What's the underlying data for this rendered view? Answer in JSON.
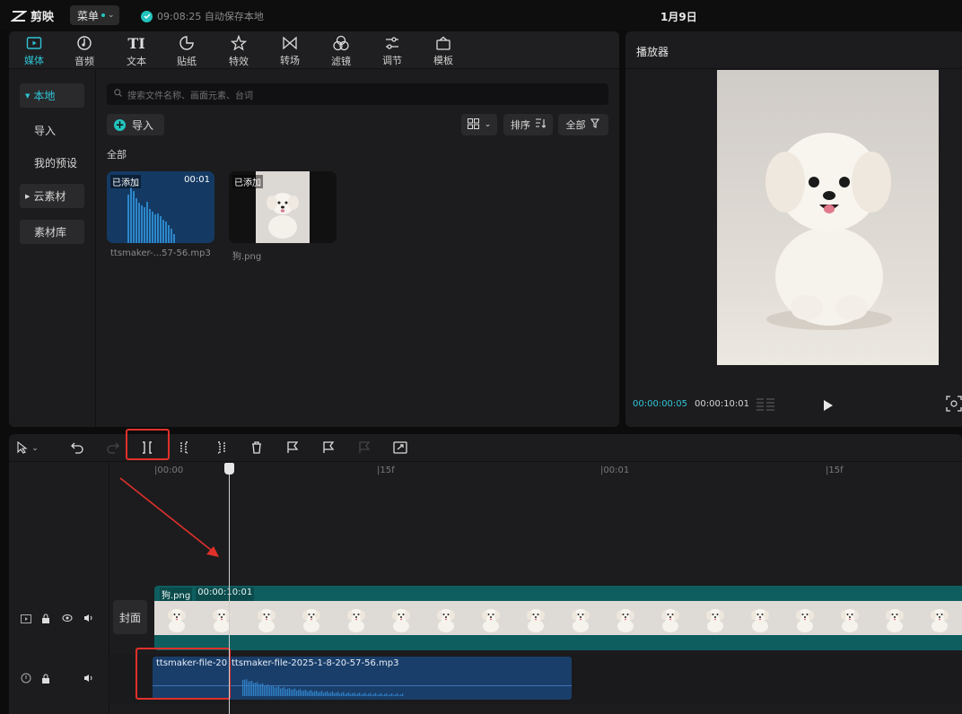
{
  "app": {
    "name": "剪映",
    "menu_label": "菜单",
    "save_status": "09:08:25 自动保存本地",
    "project_title": "1月9日"
  },
  "media_tabs": [
    {
      "label": "媒体",
      "icon": "media-icon",
      "active": true
    },
    {
      "label": "音频",
      "icon": "audio-icon"
    },
    {
      "label": "文本",
      "icon": "text-icon"
    },
    {
      "label": "贴纸",
      "icon": "sticker-icon"
    },
    {
      "label": "特效",
      "icon": "effects-icon"
    },
    {
      "label": "转场",
      "icon": "transition-icon"
    },
    {
      "label": "滤镜",
      "icon": "filter-icon"
    },
    {
      "label": "调节",
      "icon": "adjust-icon"
    },
    {
      "label": "模板",
      "icon": "template-icon"
    }
  ],
  "sidebar": {
    "local": "本地",
    "import": "导入",
    "presets": "我的预设",
    "cloud": "云素材",
    "library": "素材库"
  },
  "search": {
    "placeholder": "搜索文件名称、画面元素、台词"
  },
  "toolbar_media": {
    "import_label": "导入",
    "sort_label": "排序",
    "filter_label": "全部",
    "section_label": "全部"
  },
  "media_items": [
    {
      "badge": "已添加",
      "duration": "00:01",
      "name": "ttsmaker-...57-56.mp3"
    },
    {
      "badge": "已添加",
      "name": "狗.png"
    }
  ],
  "player": {
    "title": "播放器",
    "current_time": "00:00:00:05",
    "total_time": "00:00:10:01"
  },
  "timeline": {
    "ruler_ticks": [
      "00:00",
      "15f",
      "00:01",
      "15f"
    ],
    "cover_label": "封面",
    "video_clip": {
      "name": "狗.png",
      "duration": "00:00:10:01"
    },
    "audio_clip": {
      "name_left": "ttsmaker-file-20",
      "name_right": "ttsmaker-file-2025-1-8-20-57-56.mp3"
    }
  },
  "colors": {
    "accent": "#2ec4d6",
    "highlight": "#e0302a",
    "video_track": "#0e5e5f",
    "audio_track": "#1a3e6a"
  }
}
